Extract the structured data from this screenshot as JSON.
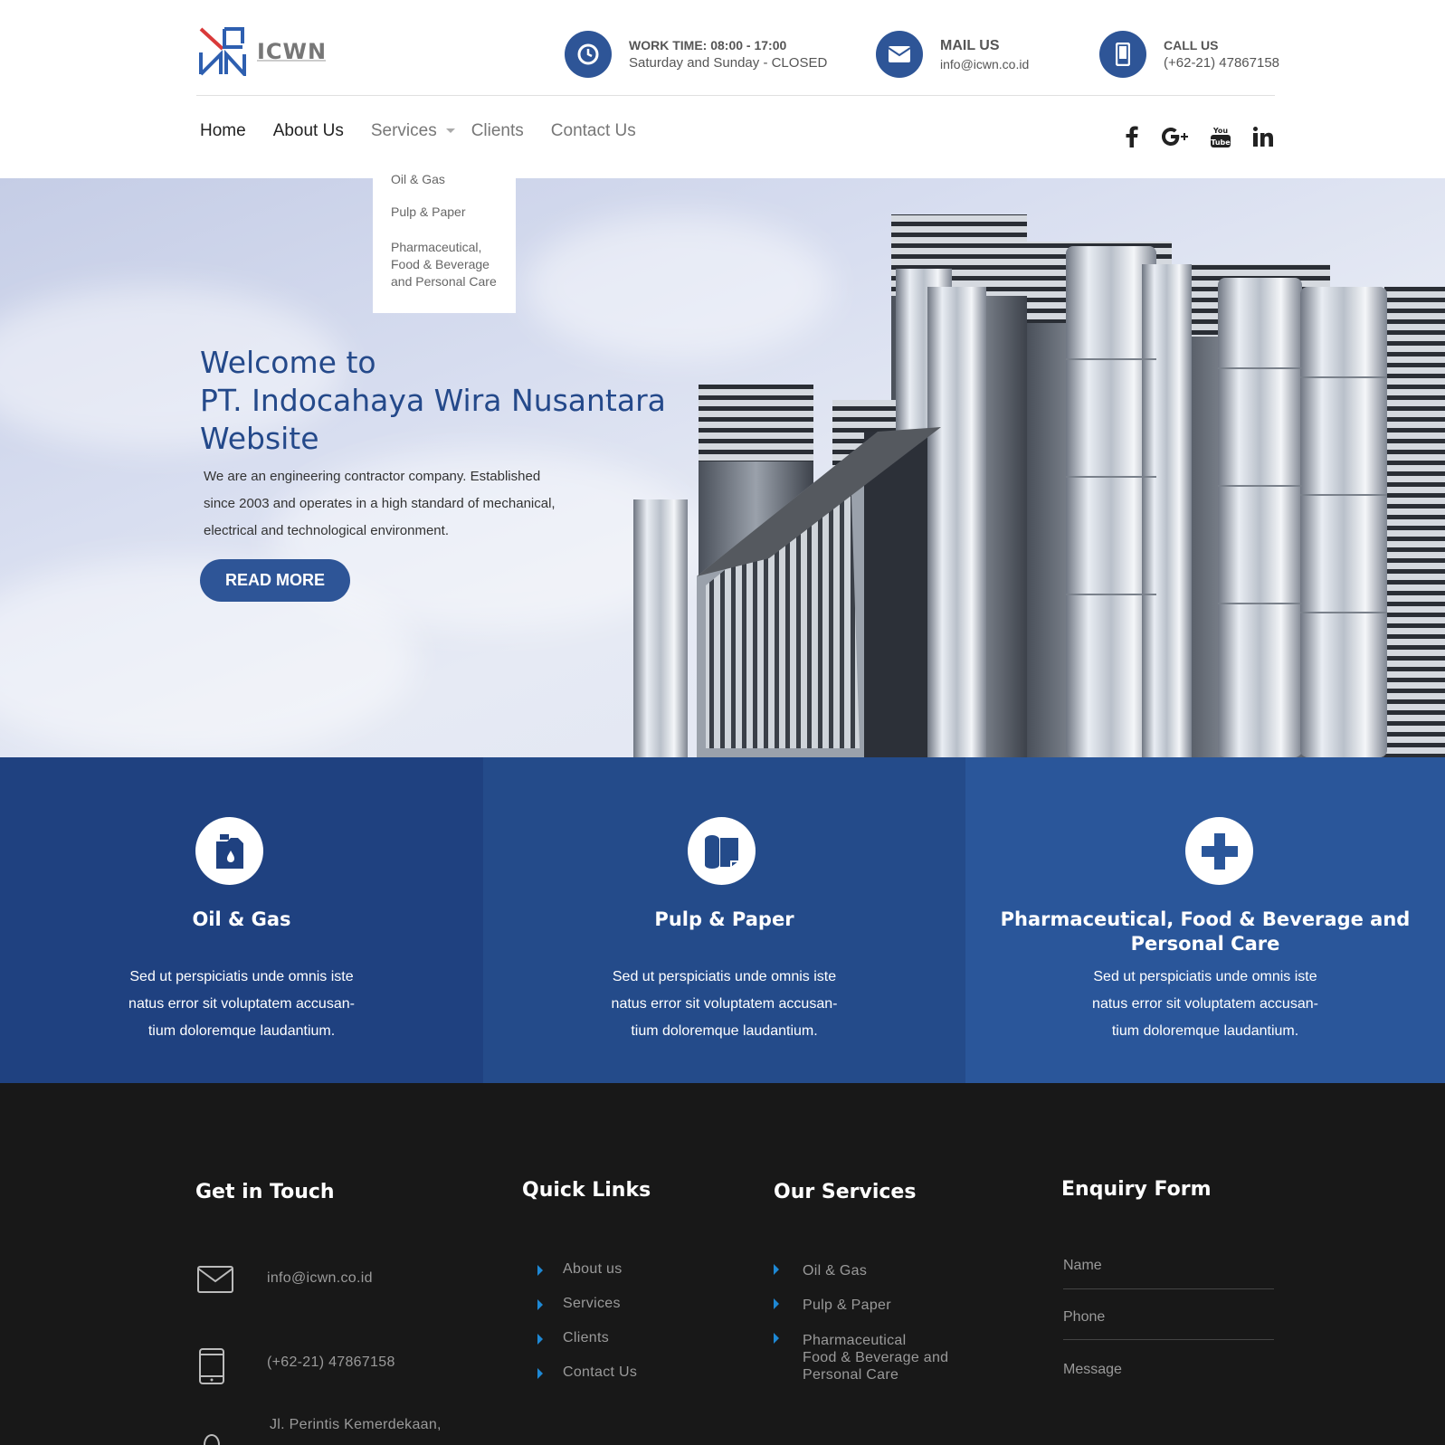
{
  "header": {
    "logo_text": "ICWN",
    "work": {
      "label": "WORK TIME: 08:00 - 17:00",
      "value": "Saturday and Sunday - CLOSED"
    },
    "mail": {
      "label": "MAIL US",
      "value": "info@icwn.co.id"
    },
    "call": {
      "label": "CALL US",
      "value": "(+62-21) 47867158"
    }
  },
  "nav": {
    "items": [
      "Home",
      "About Us",
      "Services",
      "Clients",
      "Contact Us"
    ],
    "dropdown": [
      "Oil & Gas",
      "Pulp & Paper",
      "Pharmaceutical,",
      "Food & Beverage",
      "and Personal Care"
    ]
  },
  "hero": {
    "title_line1": "Welcome to",
    "title_line2": "PT. Indocahaya Wira Nusantara",
    "title_line3": "Website",
    "text_line1": "We are an engineering contractor company. Established",
    "text_line2": "since 2003 and operates in a high standard of mechanical,",
    "text_line3": "electrical and technological environment.",
    "button": "READ MORE"
  },
  "services": [
    {
      "title": "Oil & Gas",
      "desc": [
        "Sed ut perspiciatis unde omnis iste",
        "natus error sit voluptatem accusan-",
        "tium doloremque laudantium."
      ],
      "color": "#1f4180"
    },
    {
      "title": "Pulp & Paper",
      "desc": [
        "Sed ut perspiciatis unde omnis iste",
        "natus error sit voluptatem accusan-",
        "tium doloremque laudantium."
      ],
      "color": "#244b8a"
    },
    {
      "title_line1": "Pharmaceutical, Food & Beverage and",
      "title_line2": "Personal Care",
      "desc": [
        "Sed ut perspiciatis unde omnis iste",
        "natus error sit voluptatem accusan-",
        "tium doloremque laudantium."
      ],
      "color": "#2a569a"
    }
  ],
  "footer": {
    "get_in_touch": "Get in Touch",
    "email": "info@icwn.co.id",
    "phone": "(+62-21) 47867158",
    "address": "Jl. Perintis Kemerdekaan,",
    "quick_links_title": "Quick Links",
    "quick_links": [
      "About us",
      "Services",
      "Clients",
      "Contact Us"
    ],
    "our_services_title": "Our Services",
    "our_services": [
      "Oil & Gas",
      "Pulp & Paper",
      "Pharmaceutical",
      "Food & Beverage and",
      "Personal Care"
    ],
    "enquiry_title": "Enquiry Form",
    "form": {
      "name": "Name",
      "phone": "Phone",
      "message": "Message"
    }
  },
  "icons": {
    "clock": "clock-icon",
    "mail": "envelope-icon",
    "phone": "mobile-icon",
    "social": [
      "facebook-icon",
      "google-plus-icon",
      "youtube-icon",
      "linkedin-icon"
    ]
  },
  "colors": {
    "primary": "#2e5597",
    "title": "#24498a",
    "footer_bg": "#181818",
    "link_arrow": "#1e88d4"
  }
}
